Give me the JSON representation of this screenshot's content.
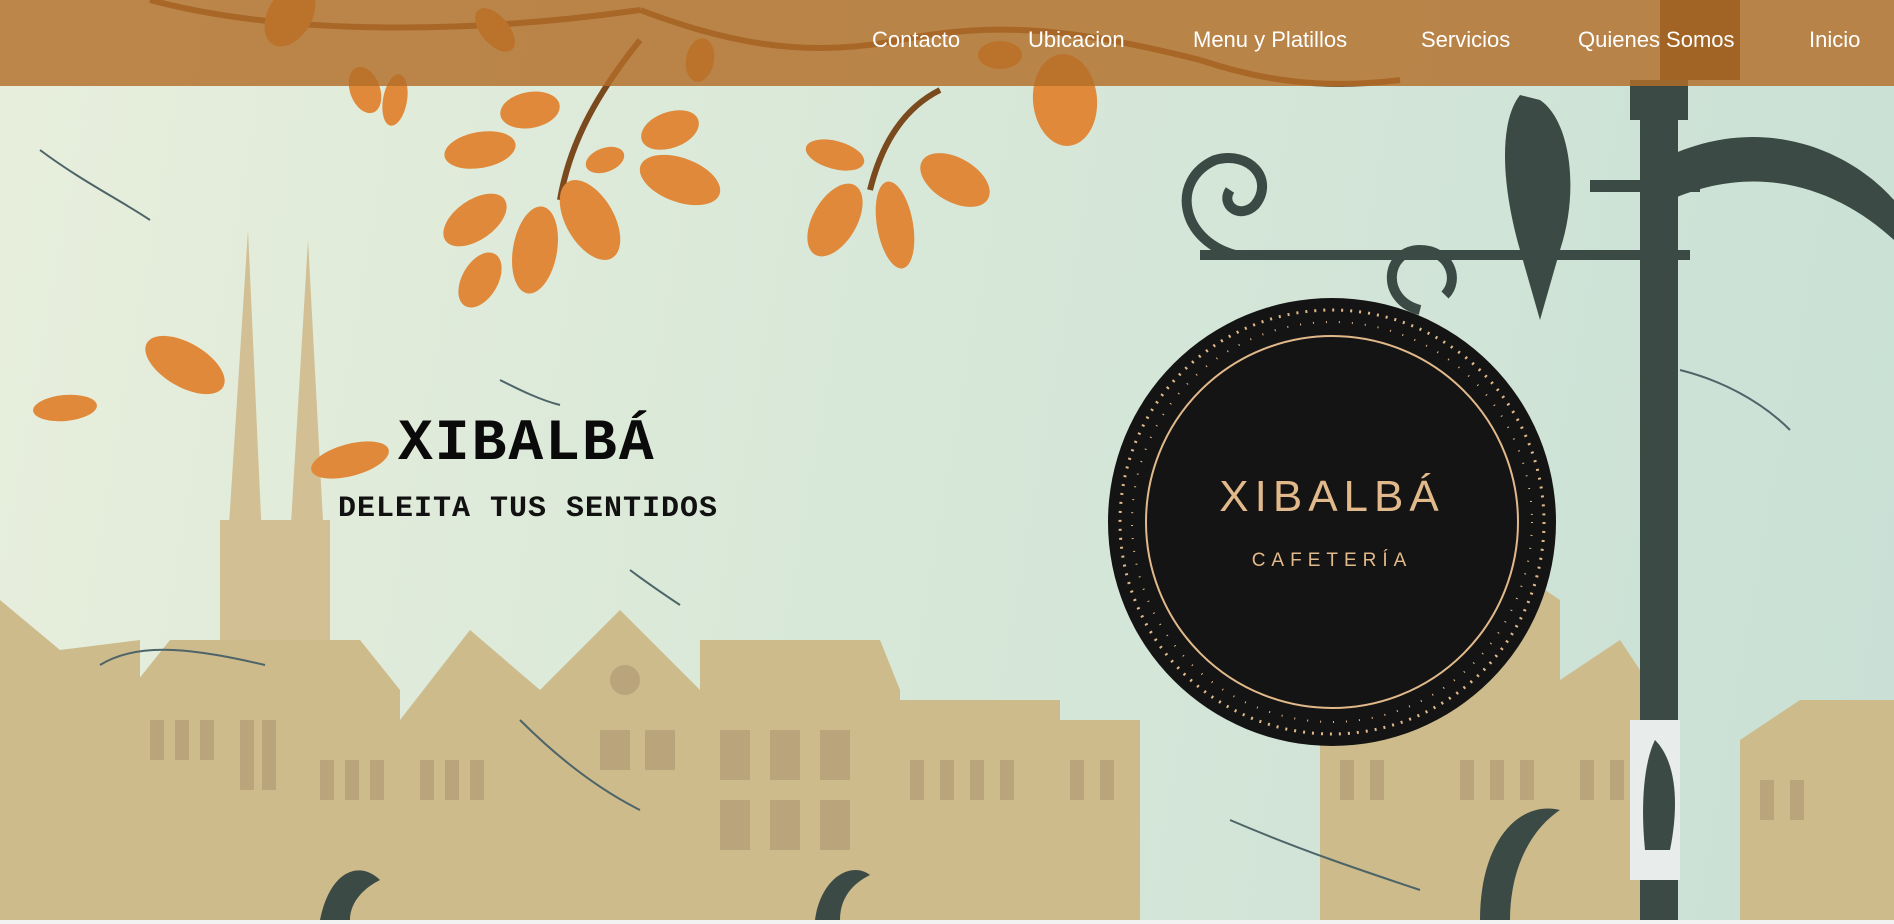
{
  "nav": {
    "items": [
      {
        "label": "Contacto"
      },
      {
        "label": "Ubicacion"
      },
      {
        "label": "Menu y Platillos"
      },
      {
        "label": "Servicios"
      },
      {
        "label": "Quienes Somos"
      },
      {
        "label": "Inicio"
      }
    ]
  },
  "hero": {
    "title": "XIBALBÁ",
    "subtitle": "DELEITA TUS SENTIDOS"
  },
  "logo": {
    "name": "XIBALBÁ",
    "subtitle": "CAFETERÍA"
  },
  "colors": {
    "navbar": "#b26e28",
    "logo_background": "#141414",
    "logo_accent": "#e2b98a",
    "leaves": "#e0893a",
    "buildings": "#c8b688",
    "lamp_post": "#3c4a46"
  }
}
